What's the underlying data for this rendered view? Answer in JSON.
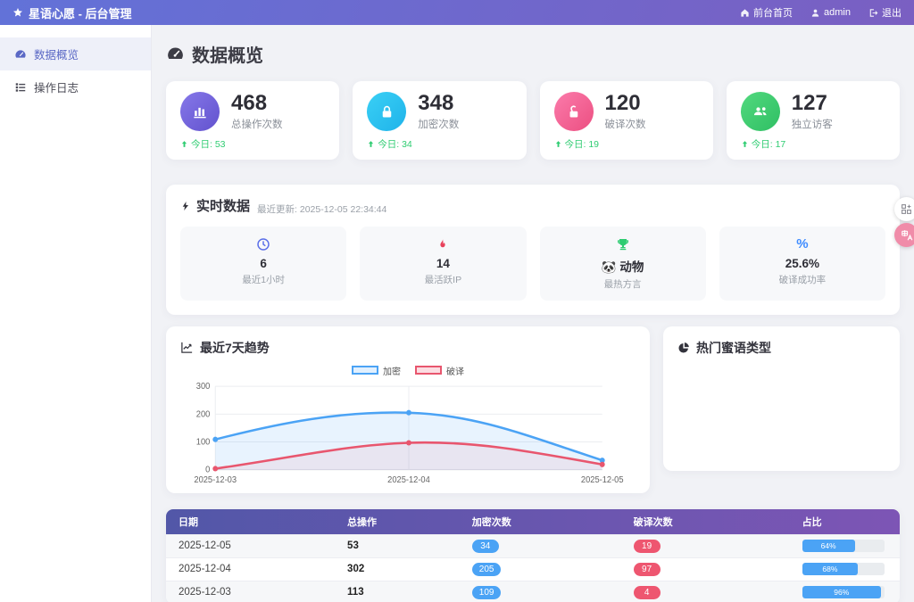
{
  "navbar": {
    "brand": "星语心愿 - 后台管理",
    "links": {
      "home": "前台首页",
      "user": "admin",
      "logout": "退出"
    }
  },
  "sidebar": {
    "items": [
      {
        "label": "数据概览",
        "active": true
      },
      {
        "label": "操作日志",
        "active": false
      }
    ]
  },
  "page": {
    "title": "数据概览"
  },
  "stats": [
    {
      "value": "468",
      "label": "总操作次数",
      "today": "今日: 53",
      "icon": "bar-chart-icon",
      "color": "#6252ce"
    },
    {
      "value": "348",
      "label": "加密次数",
      "today": "今日: 34",
      "icon": "lock-icon",
      "color": "#1fb3ea"
    },
    {
      "value": "120",
      "label": "破译次数",
      "today": "今日: 19",
      "icon": "unlock-icon",
      "color": "#ec4f81"
    },
    {
      "value": "127",
      "label": "独立访客",
      "today": "今日: 17",
      "icon": "users-icon",
      "color": "#2fbf63"
    }
  ],
  "realtime": {
    "title": "实时数据",
    "updated": "最近更新: 2025-12-05 22:34:44",
    "cards": [
      {
        "value": "6",
        "label": "最近1小时",
        "icon": "clock-icon",
        "icon_color": "#5b6fe8"
      },
      {
        "value": "14",
        "label": "最活跃IP",
        "icon": "fire-icon",
        "icon_color": "#e8405a"
      },
      {
        "value": "🐼 动物",
        "label": "最热方言",
        "icon": "trophy-icon",
        "icon_color": "#2ecc71"
      },
      {
        "value": "25.6%",
        "label": "破译成功率",
        "icon": "percent-icon",
        "icon_color": "#3f8cff",
        "percent_glyph": "%"
      }
    ]
  },
  "trend": {
    "title": "最近7天趋势"
  },
  "pie": {
    "title": "热门蜜语类型"
  },
  "chart_data": {
    "type": "line",
    "x": [
      "2025-12-03",
      "2025-12-04",
      "2025-12-05"
    ],
    "series": [
      {
        "name": "加密",
        "color": "#4ba3f5",
        "values": [
          109,
          205,
          34
        ]
      },
      {
        "name": "破译",
        "color": "#e8566e",
        "values": [
          4,
          97,
          19
        ]
      }
    ],
    "yticks": [
      "300",
      "200",
      "100",
      "0"
    ],
    "ylim": [
      0,
      300
    ],
    "grid": true,
    "legend_position": "top",
    "smooth": true,
    "area_fill": true
  },
  "table": {
    "headers": [
      "日期",
      "总操作",
      "加密次数",
      "破译次数",
      "占比"
    ],
    "rows": [
      {
        "date": "2025-12-05",
        "total": "53",
        "encrypt": "34",
        "decrypt": "19",
        "ratio": "64%",
        "ratio_pct": 64
      },
      {
        "date": "2025-12-04",
        "total": "302",
        "encrypt": "205",
        "decrypt": "97",
        "ratio": "68%",
        "ratio_pct": 68
      },
      {
        "date": "2025-12-03",
        "total": "113",
        "encrypt": "109",
        "decrypt": "4",
        "ratio": "96%",
        "ratio_pct": 96
      }
    ]
  },
  "colors": {
    "navbar_gradient": [
      "#6272d8",
      "#7a5fc2"
    ],
    "table_header_gradient": [
      "#5257a8",
      "#7d55b5"
    ],
    "accent_blue": "#4ba3f5",
    "accent_red": "#ee5670",
    "success_green": "#2ecc71",
    "sidebar_active": "#5a68c5"
  }
}
